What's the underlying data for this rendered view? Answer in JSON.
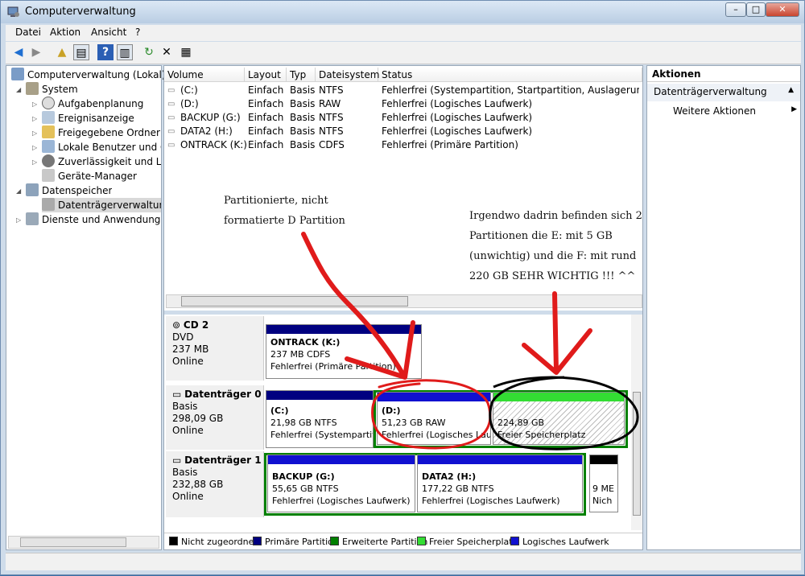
{
  "window": {
    "title": "Computerverwaltung",
    "controls": [
      "–",
      "□",
      "✕"
    ]
  },
  "menu": [
    "Datei",
    "Aktion",
    "Ansicht",
    "?"
  ],
  "toolbar": [
    "back-icon",
    "forward-icon",
    "up-icon",
    "show-tree-icon",
    "help-icon",
    "pane-icon",
    "refresh-icon",
    "delete-icon",
    "properties-icon"
  ],
  "tree": {
    "root": "Computerverwaltung (Lokal)",
    "system": "System",
    "aufgaben": "Aufgabenplanung",
    "ereignis": "Ereignisanzeige",
    "freigabe": "Freigegebene Ordner",
    "benutzer": "Lokale Benutzer und Gru",
    "zuverl": "Zuverlässigkeit und Leis",
    "geraete": "Geräte-Manager",
    "daten": "Datenspeicher",
    "dtv": "Datenträgerverwaltung",
    "dienste": "Dienste und Anwendungen"
  },
  "volumes": {
    "headers": [
      "Volume",
      "Layout",
      "Typ",
      "Dateisystem",
      "Status"
    ],
    "rows": [
      [
        "(C:)",
        "Einfach",
        "Basis",
        "NTFS",
        "Fehlerfrei (Systempartition, Startpartition, Auslagerungsdatei,"
      ],
      [
        "(D:)",
        "Einfach",
        "Basis",
        "RAW",
        "Fehlerfrei (Logisches Laufwerk)"
      ],
      [
        "BACKUP (G:)",
        "Einfach",
        "Basis",
        "NTFS",
        "Fehlerfrei (Logisches Laufwerk)"
      ],
      [
        "DATA2 (H:)",
        "Einfach",
        "Basis",
        "NTFS",
        "Fehlerfrei (Logisches Laufwerk)"
      ],
      [
        "ONTRACK (K:)",
        "Einfach",
        "Basis",
        "CDFS",
        "Fehlerfrei (Primäre Partition)"
      ]
    ]
  },
  "disks": {
    "cd2": {
      "name": "CD 2",
      "type": "DVD",
      "size": "237 MB",
      "state": "Online"
    },
    "d0": {
      "name": "Datenträger 0",
      "type": "Basis",
      "size": "298,09 GB",
      "state": "Online"
    },
    "d1": {
      "name": "Datenträger 1",
      "type": "Basis",
      "size": "232,88 GB",
      "state": "Online"
    }
  },
  "partitions": {
    "k": {
      "name": "ONTRACK  (K:)",
      "size": "237 MB CDFS",
      "status": "Fehlerfrei (Primäre Partition)"
    },
    "c": {
      "name": "(C:)",
      "size": "21,98 GB NTFS",
      "status": "Fehlerfrei (Systempartiti"
    },
    "d": {
      "name": "(D:)",
      "size": "51,23 GB RAW",
      "status": "Fehlerfrei (Logisches Lau"
    },
    "free": {
      "size": "224,89 GB",
      "status": "Freier Speicherplatz"
    },
    "g": {
      "name": "BACKUP  (G:)",
      "size": "55,65 GB NTFS",
      "status": "Fehlerfrei (Logisches Laufwerk)"
    },
    "h": {
      "name": "DATA2  (H:)",
      "size": "177,22 GB NTFS",
      "status": "Fehlerfrei (Logisches Laufwerk)"
    },
    "small": {
      "size": "9 ME",
      "status": "Nich"
    }
  },
  "legend": [
    "Nicht zugeordnet",
    "Primäre Partition",
    "Erweiterte Partition",
    "Freier Speicherplatz",
    "Logisches Laufwerk"
  ],
  "colors": {
    "unalloc": "#000000",
    "primary": "#000080",
    "extended": "#008000",
    "free": "#33dd33",
    "logical": "#1010d0"
  },
  "actions": {
    "header": "Aktionen",
    "section": "Datenträgerverwaltung",
    "more": "Weitere Aktionen"
  },
  "annotations": {
    "left1": "Partitionierte, nicht",
    "left2": "formatierte D Partition",
    "right1": "Irgendwo dadrin befinden sich 2",
    "right2": "Partitionen die E: mit 5 GB",
    "right3": "(unwichtig) und die F: mit rund",
    "right4": "220 GB SEHR WICHTIG !!! ^^"
  }
}
